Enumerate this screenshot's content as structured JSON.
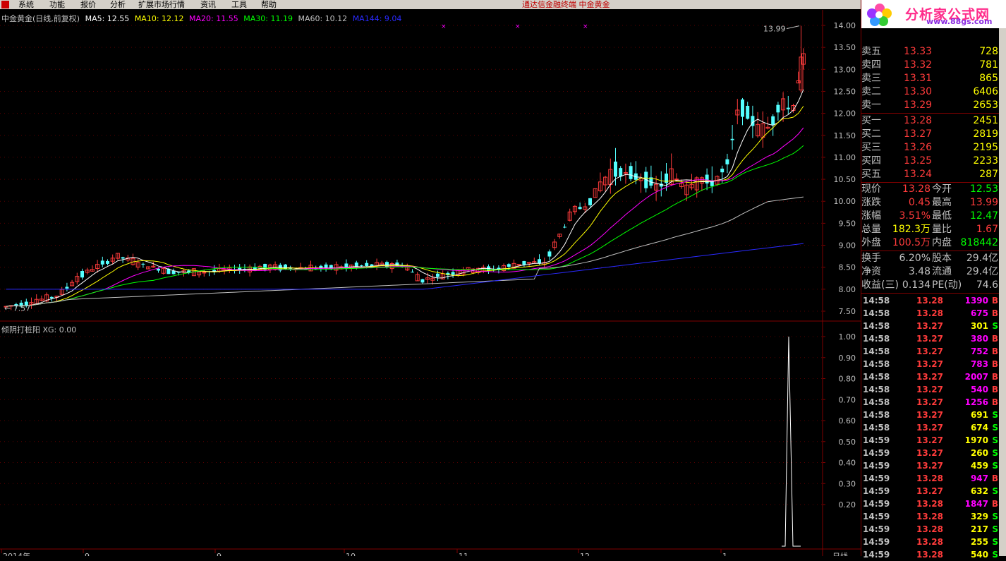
{
  "menubar": {
    "items": [
      "系统",
      "功能",
      "报价",
      "分析",
      "扩展市场行情",
      "资讯",
      "工具",
      "帮助"
    ],
    "center_text": "通达信金融终端    中金黄金"
  },
  "legend": {
    "title": "中金黄金(日线,前复权)",
    "ma": [
      {
        "label": "MA5: 12.55",
        "color": "#ffffff"
      },
      {
        "label": "MA10: 12.12",
        "color": "#ffff00"
      },
      {
        "label": "MA20: 11.55",
        "color": "#ff00ff"
      },
      {
        "label": "MA30: 11.19",
        "color": "#00ff00"
      },
      {
        "label": "MA60: 10.12",
        "color": "#c0c0c0"
      },
      {
        "label": "MA144: 9.04",
        "color": "#0000ff"
      }
    ]
  },
  "indicator": {
    "label": "倾阴打桩阳 XG: 0.00"
  },
  "price_axis": [
    "14.00",
    "13.50",
    "13.00",
    "12.50",
    "12.00",
    "11.50",
    "11.00",
    "10.50",
    "10.00",
    "9.50",
    "9.00",
    "8.50",
    "8.00",
    "7.50"
  ],
  "indicator_axis": [
    "1.00",
    "0.90",
    "0.80",
    "0.70",
    "0.60",
    "0.50",
    "0.40",
    "0.30",
    "0.20"
  ],
  "annotations": {
    "high": "13.99",
    "low": "7.57"
  },
  "date_axis": [
    "2014年",
    "9",
    "9",
    "10",
    "11",
    "12",
    "1"
  ],
  "period_label": "日线",
  "logo": {
    "brand": "分析家公式网",
    "url": "www.88gs.com"
  },
  "order_book": {
    "asks": [
      {
        "label": "卖五",
        "price": "13.33",
        "vol": "728"
      },
      {
        "label": "卖四",
        "price": "13.32",
        "vol": "781"
      },
      {
        "label": "卖三",
        "price": "13.31",
        "vol": "865"
      },
      {
        "label": "卖二",
        "price": "13.30",
        "vol": "6406"
      },
      {
        "label": "卖一",
        "price": "13.29",
        "vol": "2653"
      }
    ],
    "bids": [
      {
        "label": "买一",
        "price": "13.28",
        "vol": "2451"
      },
      {
        "label": "买二",
        "price": "13.27",
        "vol": "2819"
      },
      {
        "label": "买三",
        "price": "13.26",
        "vol": "2195"
      },
      {
        "label": "买四",
        "price": "13.25",
        "vol": "2233"
      },
      {
        "label": "买五",
        "price": "13.24",
        "vol": "287"
      }
    ]
  },
  "quote": [
    {
      "l1": "现价",
      "v1": "13.28",
      "c1": "#ff3b3b",
      "l2": "今开",
      "v2": "12.53",
      "c2": "#00ff00"
    },
    {
      "l1": "涨跌",
      "v1": "0.45",
      "c1": "#ff3b3b",
      "l2": "最高",
      "v2": "13.99",
      "c2": "#ff3b3b"
    },
    {
      "l1": "涨幅",
      "v1": "3.51%",
      "c1": "#ff3b3b",
      "l2": "最低",
      "v2": "12.47",
      "c2": "#00ff00"
    },
    {
      "l1": "总量",
      "v1": "182.3万",
      "c1": "#ffff00",
      "l2": "量比",
      "v2": "1.67",
      "c2": "#ff3b3b"
    },
    {
      "l1": "外盘",
      "v1": "100.5万",
      "c1": "#ff3b3b",
      "l2": "内盘",
      "v2": "818442",
      "c2": "#00ff00"
    }
  ],
  "fundamentals": [
    {
      "l1": "换手",
      "v1": "6.20%",
      "l2": "股本",
      "v2": "29.4亿"
    },
    {
      "l1": "净资",
      "v1": "3.48",
      "l2": "流通",
      "v2": "29.4亿"
    },
    {
      "l1": "收益(三)",
      "v1": "0.134",
      "l2": "PE(动)",
      "v2": "74.6"
    }
  ],
  "ticks": [
    {
      "time": "14:58",
      "price": "13.28",
      "vol": "1390",
      "dir": "B"
    },
    {
      "time": "14:58",
      "price": "13.28",
      "vol": "675",
      "dir": "B"
    },
    {
      "time": "14:58",
      "price": "13.27",
      "vol": "301",
      "dir": "S"
    },
    {
      "time": "14:58",
      "price": "13.27",
      "vol": "380",
      "dir": "B"
    },
    {
      "time": "14:58",
      "price": "13.27",
      "vol": "752",
      "dir": "B"
    },
    {
      "time": "14:58",
      "price": "13.27",
      "vol": "783",
      "dir": "B"
    },
    {
      "time": "14:58",
      "price": "13.27",
      "vol": "2007",
      "dir": "B"
    },
    {
      "time": "14:58",
      "price": "13.27",
      "vol": "540",
      "dir": "B"
    },
    {
      "time": "14:58",
      "price": "13.27",
      "vol": "1256",
      "dir": "B"
    },
    {
      "time": "14:58",
      "price": "13.27",
      "vol": "691",
      "dir": "S"
    },
    {
      "time": "14:58",
      "price": "13.27",
      "vol": "674",
      "dir": "S"
    },
    {
      "time": "14:59",
      "price": "13.27",
      "vol": "1970",
      "dir": "S"
    },
    {
      "time": "14:59",
      "price": "13.27",
      "vol": "260",
      "dir": "S"
    },
    {
      "time": "14:59",
      "price": "13.27",
      "vol": "459",
      "dir": "S"
    },
    {
      "time": "14:59",
      "price": "13.28",
      "vol": "947",
      "dir": "B"
    },
    {
      "time": "14:59",
      "price": "13.27",
      "vol": "632",
      "dir": "S"
    },
    {
      "time": "14:59",
      "price": "13.28",
      "vol": "1847",
      "dir": "B"
    },
    {
      "time": "14:59",
      "price": "13.28",
      "vol": "329",
      "dir": "S"
    },
    {
      "time": "14:59",
      "price": "13.28",
      "vol": "217",
      "dir": "S"
    },
    {
      "time": "14:59",
      "price": "13.28",
      "vol": "255",
      "dir": "S"
    },
    {
      "time": "14:59",
      "price": "13.28",
      "vol": "540",
      "dir": "S"
    }
  ]
}
